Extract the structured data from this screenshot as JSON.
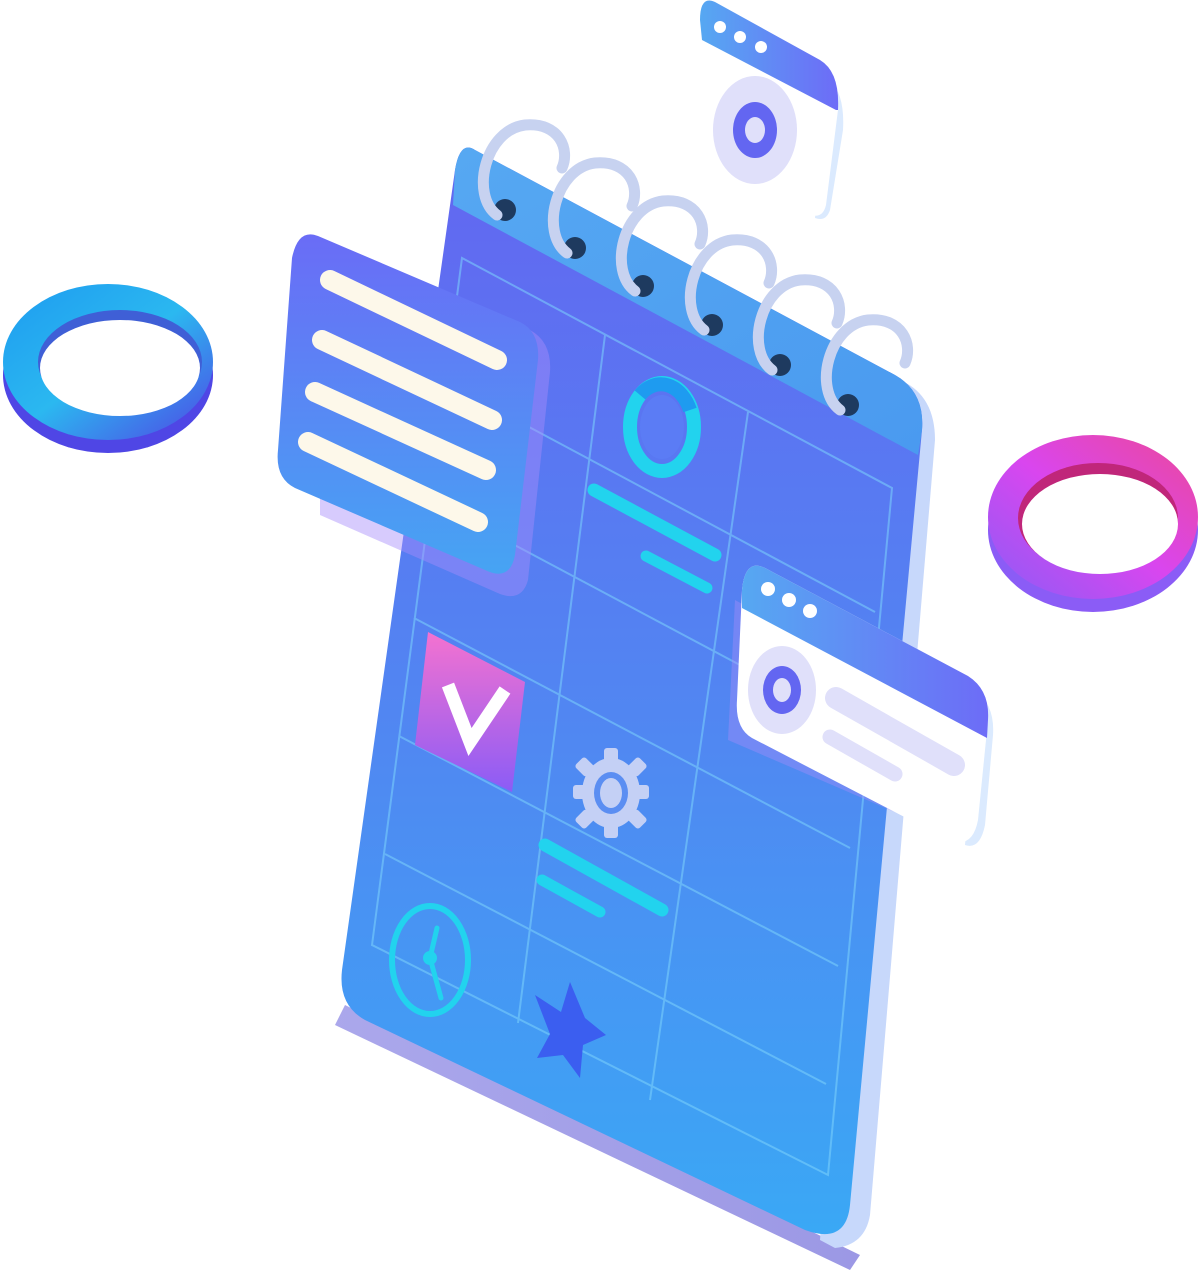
{
  "illustration": {
    "icons": [
      "calendar-icon",
      "ring-icon",
      "checkmark-icon",
      "gear-icon",
      "clock-icon",
      "star-icon",
      "browser-window-icon",
      "text-card-icon"
    ]
  },
  "colors": {
    "calendar_top": "#6366f1",
    "calendar_bottom": "#3aa8f5",
    "grid_line": "#7dd3fc",
    "cyan_accent": "#22d3ee",
    "blue_ring_a": "#1e9bf0",
    "blue_ring_b": "#4f46e5",
    "pink_ring_a": "#ec4899",
    "pink_ring_b": "#8b5cf6",
    "card_text_line": "#fdf8ea",
    "window_body": "#f5f3ff",
    "window_header": "#6d6cf7",
    "star": "#3b5ef0",
    "check_box_top": "#f472d0",
    "check_box_bottom": "#8b5cf6"
  }
}
